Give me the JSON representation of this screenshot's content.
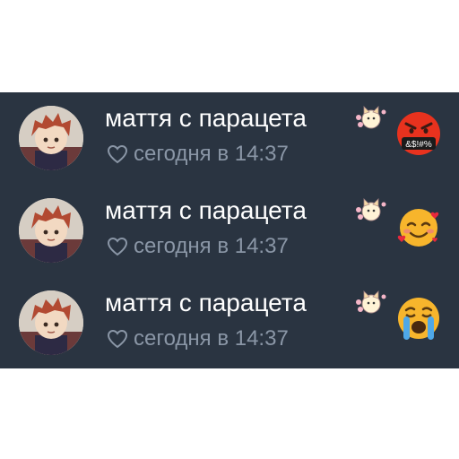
{
  "messages": [
    {
      "name": "маття с парацета",
      "time": "сегодня в 14:37",
      "reaction": "angry-face-icon",
      "reaction_text": "&$!#%"
    },
    {
      "name": "маття с парацета",
      "time": "сегодня в 14:37",
      "reaction": "smiling-face-with-hearts-icon"
    },
    {
      "name": "маття с парацета",
      "time": "сегодня в 14:37",
      "reaction": "crying-face-icon"
    }
  ],
  "colors": {
    "panel": "#2a3441",
    "name": "#ffffff",
    "time": "#8a96a6",
    "angry": "#e8321e",
    "emoji_yellow": "#f7b52c"
  }
}
